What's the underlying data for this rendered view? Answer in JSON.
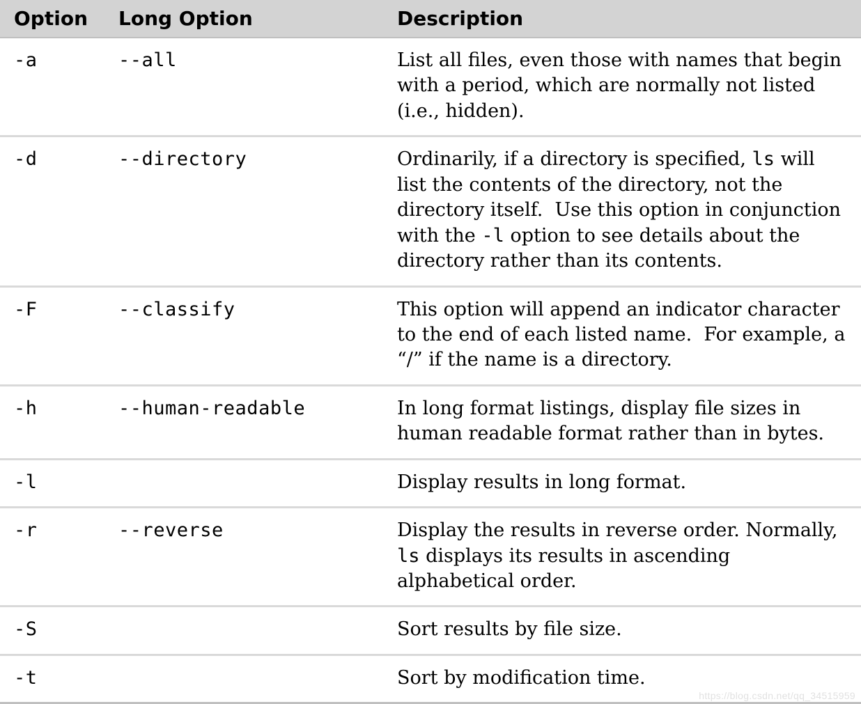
{
  "table": {
    "headers": {
      "option": "Option",
      "long_option": "Long Option",
      "description": "Description"
    },
    "rows": [
      {
        "short": "-a",
        "long": "--all",
        "desc_html": "List all files, even those with names that begin with a period, which are normally not listed (i.e., hidden)."
      },
      {
        "short": "-d",
        "long": "--directory",
        "desc_html": "Ordinarily, if a directory is specified, <span class=\"inline-mono\">ls</span> will list the contents of the directory, not the directory itself.&nbsp; Use this option in conjunction with the <span class=\"inline-mono\">-l</span> option to see details about the directory rather than its contents."
      },
      {
        "short": "-F",
        "long": "--classify",
        "desc_html": "This option will append an indicator character to the end of each listed name.&nbsp; For example, a &ldquo;/&rdquo; if the name is a directory."
      },
      {
        "short": "-h",
        "long": "--human-readable",
        "desc_html": "In long format listings, display file sizes in human readable format rather than in bytes."
      },
      {
        "short": "-l",
        "long": "",
        "desc_html": "Display results in long format."
      },
      {
        "short": "-r",
        "long": "--reverse",
        "desc_html": "Display the results in reverse order. Normally, <span class=\"inline-mono\">ls</span> displays its results in ascending alphabetical order."
      },
      {
        "short": "-S",
        "long": "",
        "desc_html": "Sort results by file size."
      },
      {
        "short": "-t",
        "long": "",
        "desc_html": "Sort by modification time."
      }
    ]
  },
  "watermark": "https://blog.csdn.net/qq_34515959"
}
